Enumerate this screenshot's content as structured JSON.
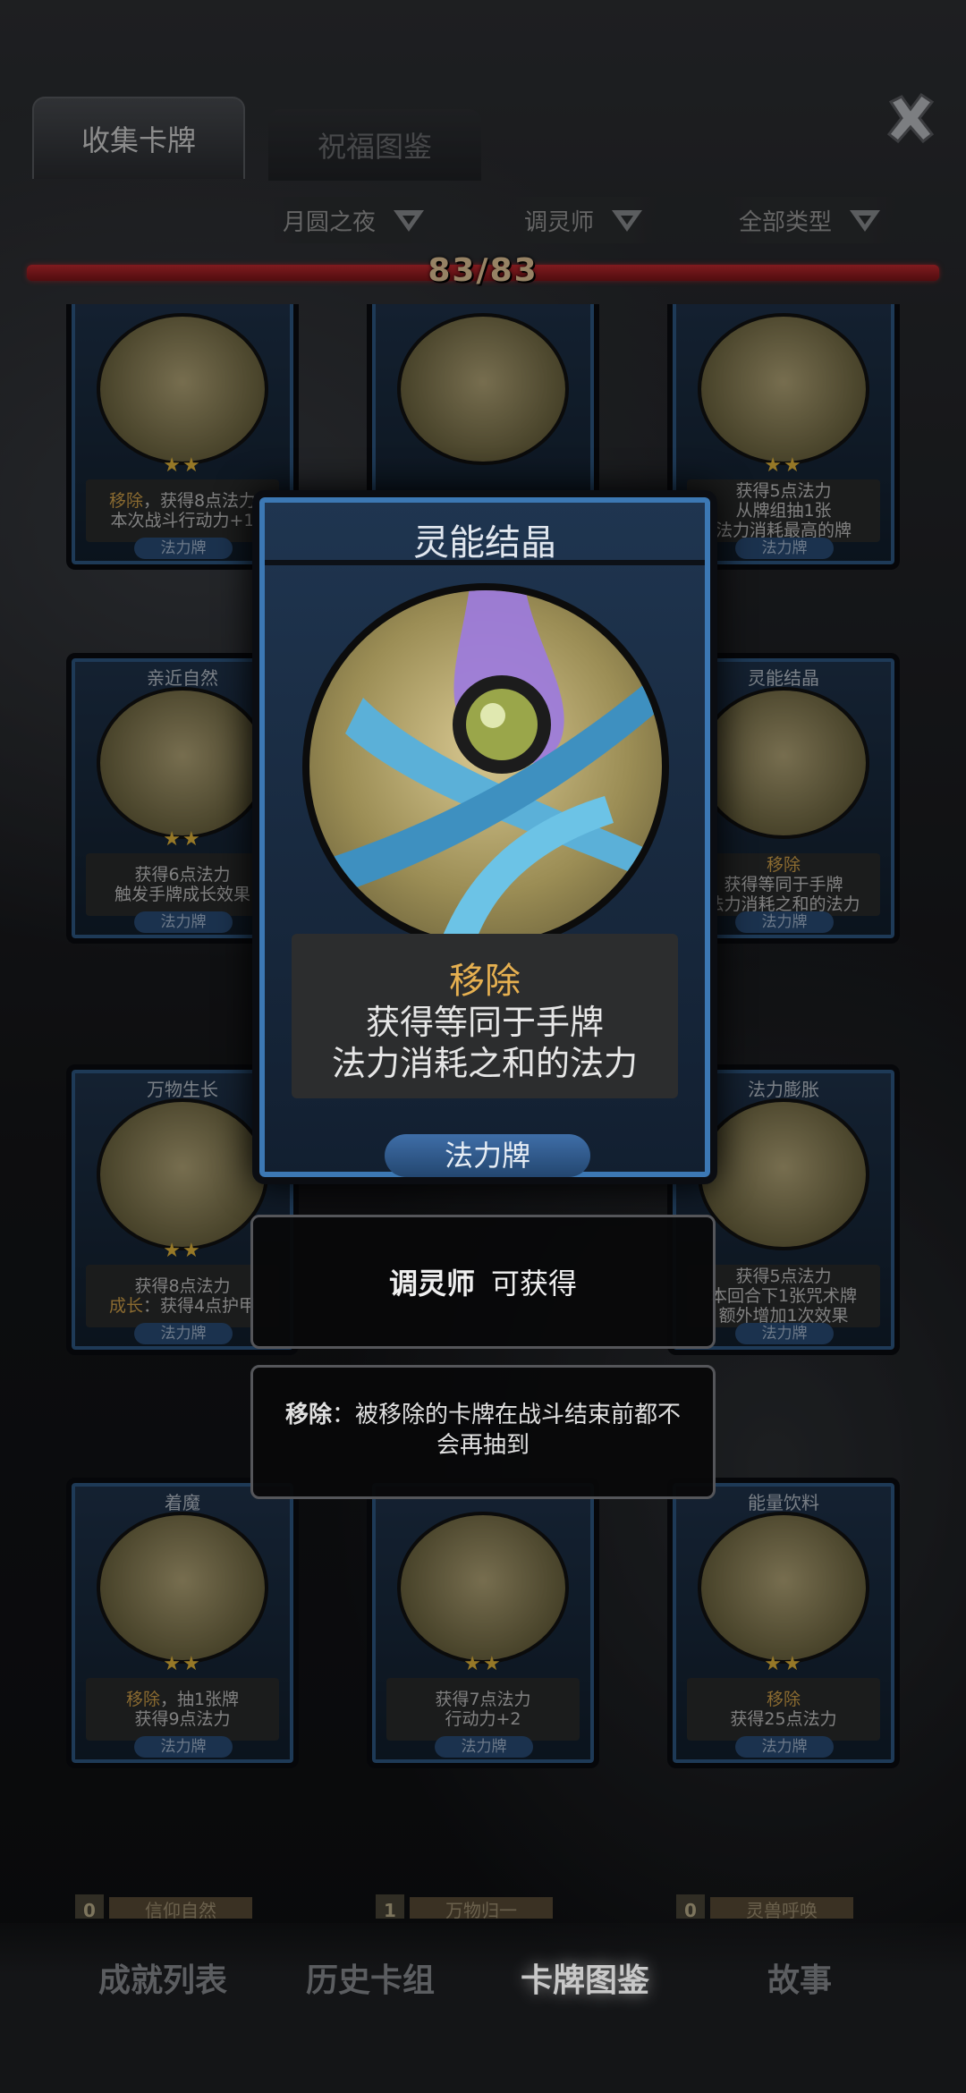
{
  "tabs": {
    "collect": "收集卡牌",
    "blessing": "祝福图鉴"
  },
  "filters": {
    "season": "月圆之夜",
    "class": "调灵师",
    "type": "全部类型"
  },
  "progress": {
    "text": "83/83",
    "collected": 83,
    "total": 83
  },
  "cards": [
    {
      "name": "",
      "stars": "★★",
      "lines": [
        "移除，获得8点法力",
        "本次战斗行动力+1"
      ],
      "highlight": "移除",
      "type": "法力牌"
    },
    {
      "name": "",
      "stars": "",
      "lines": [],
      "highlight": "",
      "type": ""
    },
    {
      "name": "",
      "stars": "★★",
      "lines": [
        "获得5点法力",
        "从牌组抽1张",
        "法力消耗最高的牌"
      ],
      "highlight": "",
      "type": "法力牌"
    },
    {
      "name": "亲近自然",
      "stars": "★★",
      "lines": [
        "获得6点法力",
        "触发手牌成长效果"
      ],
      "highlight": "成长",
      "type": "法力牌"
    },
    {
      "name": "灵能结晶",
      "stars": "",
      "lines": [
        "移除",
        "获得等同于手牌",
        "法力消耗之和的法力"
      ],
      "highlight": "移除",
      "type": "法力牌"
    },
    {
      "name": "万物生长",
      "stars": "★★",
      "lines": [
        "获得8点法力",
        "成长：获得4点护甲"
      ],
      "highlight": "成长",
      "type": "法力牌"
    },
    {
      "name": "法力膨胀",
      "stars": "",
      "lines": [
        "获得5点法力",
        "本回合下1张咒术牌",
        "额外增加1次效果"
      ],
      "highlight": "",
      "type": "法力牌"
    },
    {
      "name": "着魔",
      "stars": "★★",
      "lines": [
        "移除，抽1张牌",
        "获得9点法力"
      ],
      "highlight": "移除",
      "type": "法力牌"
    },
    {
      "name": "",
      "stars": "★★",
      "lines": [
        "获得7点法力",
        "行动力+2"
      ],
      "highlight": "",
      "type": "法力牌"
    },
    {
      "name": "能量饮料",
      "stars": "★★",
      "lines": [
        "移除",
        "获得25点法力"
      ],
      "highlight": "移除",
      "type": "法力牌"
    }
  ],
  "bottom_row": [
    {
      "num": "0",
      "label": "信仰自然"
    },
    {
      "num": "1",
      "label": "万物归一"
    },
    {
      "num": "0",
      "label": "灵兽呼唤"
    }
  ],
  "focused_card": {
    "title": "灵能结晶",
    "keyword": "移除",
    "line1": "获得等同于手牌",
    "line2": "法力消耗之和的法力",
    "type": "法力牌"
  },
  "obtain_popup": {
    "class_name": "调灵师",
    "text": "可获得"
  },
  "term_popup": {
    "term": "移除",
    "text": "：被移除的卡牌在战斗结束前都不会再抽到"
  },
  "bottom_nav": [
    "成就列表",
    "历史卡组",
    "卡牌图鉴",
    "故事"
  ],
  "active_nav": 2,
  "colors": {
    "accent_red": "#8b1a1f",
    "gold": "#e6b050",
    "card_blue": "#3c78b4"
  }
}
